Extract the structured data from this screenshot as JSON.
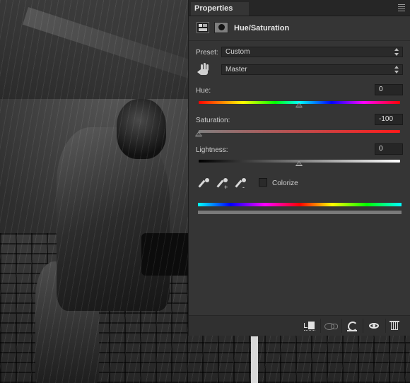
{
  "panel": {
    "tab_label": "Properties",
    "header_title": "Hue/Saturation"
  },
  "preset": {
    "label": "Preset:",
    "value": "Custom"
  },
  "channel": {
    "value": "Master"
  },
  "hue": {
    "label": "Hue:",
    "value": "0"
  },
  "saturation": {
    "label": "Saturation:",
    "value": "-100"
  },
  "lightness": {
    "label": "Lightness:",
    "value": "0"
  },
  "colorize": {
    "label": "Colorize",
    "checked": false
  },
  "eyedroppers": [
    "",
    "+",
    "-"
  ],
  "icons": {
    "panel_menu": "panel-menu-icon",
    "adjustment": "hue-saturation-icon",
    "mask": "layer-mask-icon",
    "targeted_adjustment": "targeted-adjustment-hand-icon",
    "clip": "clip-to-layer-icon",
    "view_previous": "view-previous-state-icon",
    "reset": "reset-to-defaults-icon",
    "visibility": "toggle-visibility-icon",
    "delete": "delete-adjustment-icon"
  },
  "colors": {
    "panel_bg": "#353535",
    "field_bg": "#262626",
    "text": "#d0d0d0"
  }
}
